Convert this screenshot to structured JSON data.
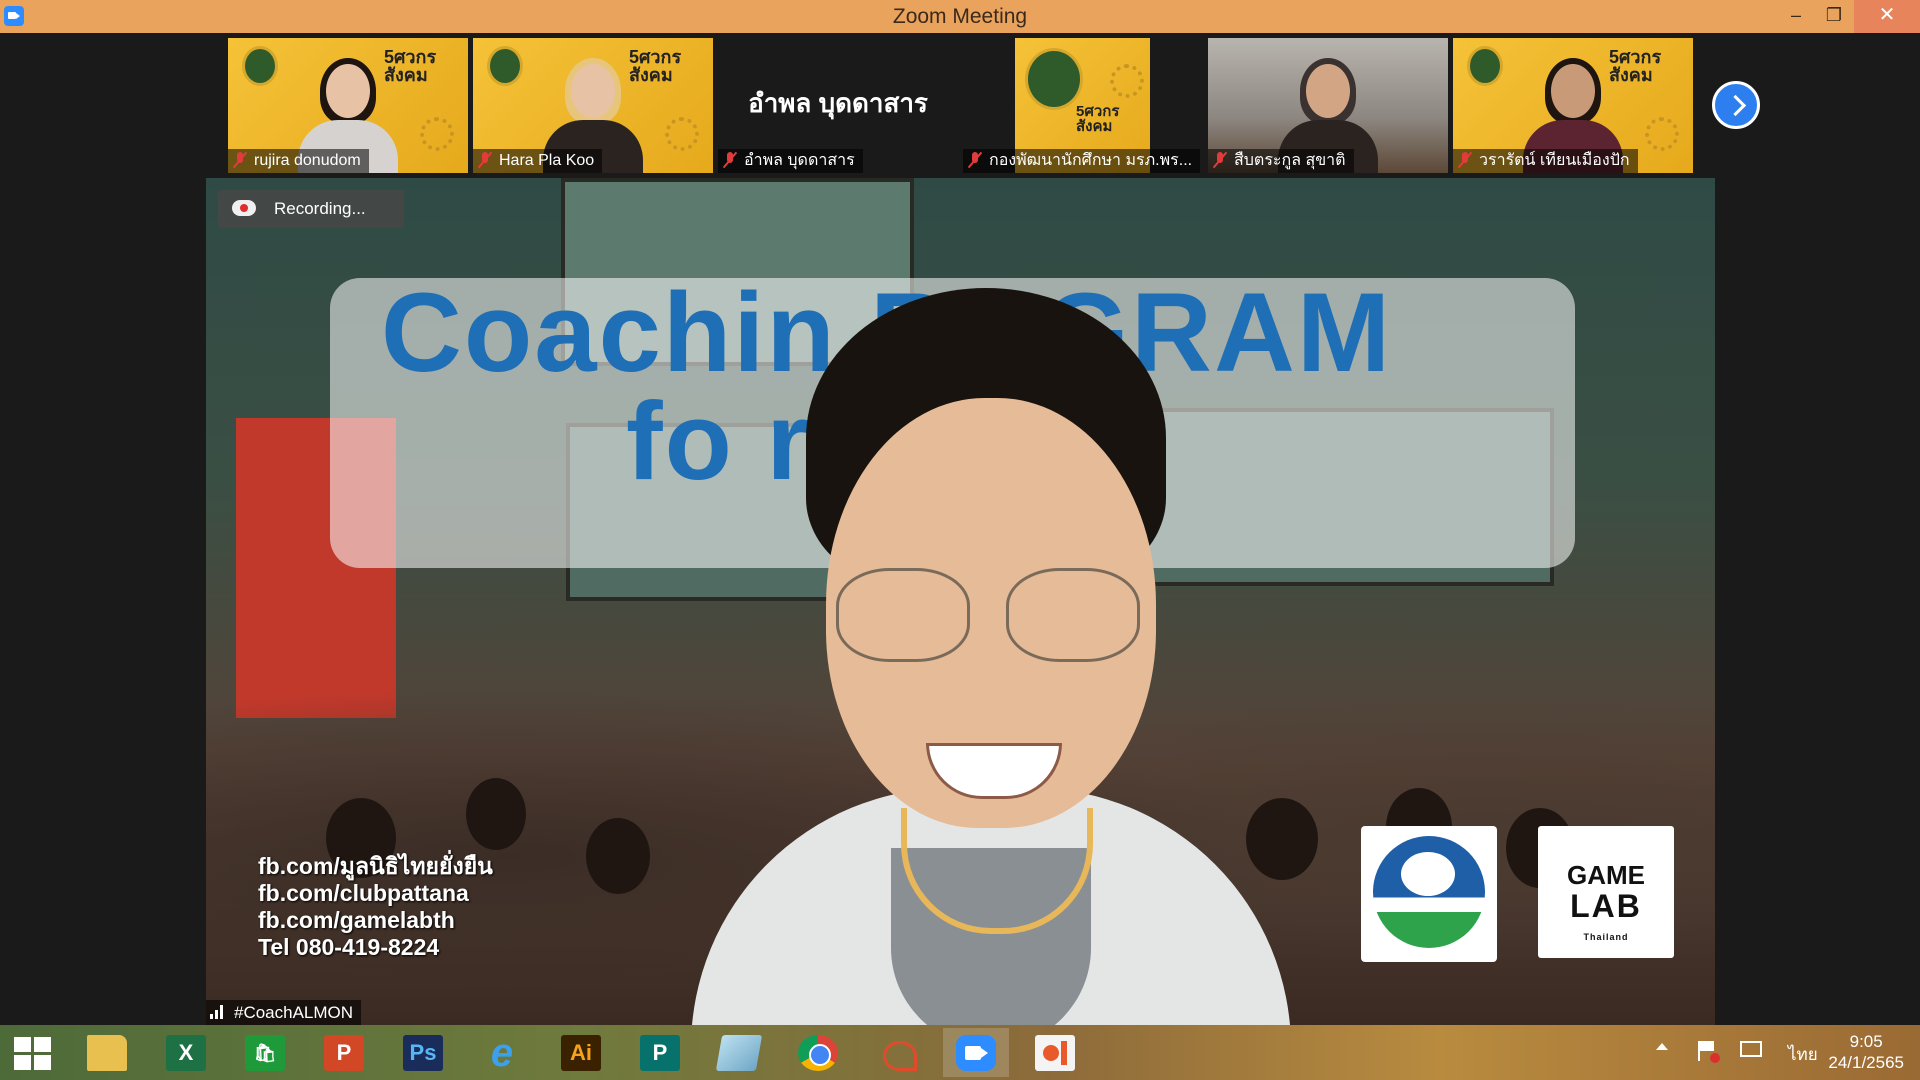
{
  "window": {
    "title": "Zoom Meeting",
    "controls": {
      "minimize": "–",
      "maximize": "❐",
      "close": "✕"
    }
  },
  "participants": [
    {
      "name": "rujira donudom",
      "style": "yellow-person",
      "muted": true,
      "banner_text": "5ศวกร สังคม"
    },
    {
      "name": "Hara Pla Koo",
      "style": "yellow-person-blond",
      "muted": true,
      "banner_text": "5ศวกร สังคม"
    },
    {
      "name": "อำพล บุดดาสาร",
      "style": "name-only",
      "muted": true,
      "display_text": "อำพล บุดดาสาร"
    },
    {
      "name": "กองพัฒนานักศึกษา มรภ.พร...",
      "style": "yellow-logo",
      "muted": true,
      "banner_text": "5ศวกร สังคม"
    },
    {
      "name": "สืบตระกูล สุขาติ",
      "style": "photo",
      "muted": true
    },
    {
      "name": "วรารัตน์ เทียนเมืองปัก",
      "style": "yellow-person-dark",
      "muted": true,
      "banner_text": "5ศวกร สังคม"
    }
  ],
  "strip": {
    "next_icon": "chevron-right-icon"
  },
  "main": {
    "recording_label": "Recording...",
    "banner_line1": "Coachin     ROGRAM",
    "banner_line2": "fo          rer",
    "contacts": [
      "fb.com/มูลนิธิไทยยั่งยืน",
      "fb.com/clubpattana",
      "fb.com/gamelabth",
      "Tel 080-419-8224"
    ],
    "speaker_name": "#CoachALMON",
    "gamelab": {
      "line1": "GAME",
      "line2": "LAB",
      "line3": "Thailand"
    }
  },
  "taskbar": {
    "apps": [
      {
        "id": "start",
        "label": ""
      },
      {
        "id": "explorer",
        "label": ""
      },
      {
        "id": "excel",
        "label": "X"
      },
      {
        "id": "store",
        "label": "🛍"
      },
      {
        "id": "powerpoint",
        "label": "P"
      },
      {
        "id": "photoshop",
        "label": "Ps"
      },
      {
        "id": "ie",
        "label": "e"
      },
      {
        "id": "illustrator",
        "label": "Ai"
      },
      {
        "id": "publisher",
        "label": "P"
      },
      {
        "id": "notepad",
        "label": ""
      },
      {
        "id": "chrome",
        "label": ""
      },
      {
        "id": "snip",
        "label": ""
      },
      {
        "id": "zoom",
        "label": ""
      },
      {
        "id": "photos",
        "label": ""
      }
    ],
    "colors": {
      "excel": "#1e7145",
      "store": "#1f9a3a",
      "powerpoint": "#d24726",
      "photoshop": "#1a2d5a",
      "ie": "#2a83d8",
      "illustrator": "#3a2100",
      "publisher": "#07726b",
      "zoom": "#2d8cff"
    },
    "language": "ไทย",
    "time": "9:05",
    "date": "24/1/2565"
  }
}
